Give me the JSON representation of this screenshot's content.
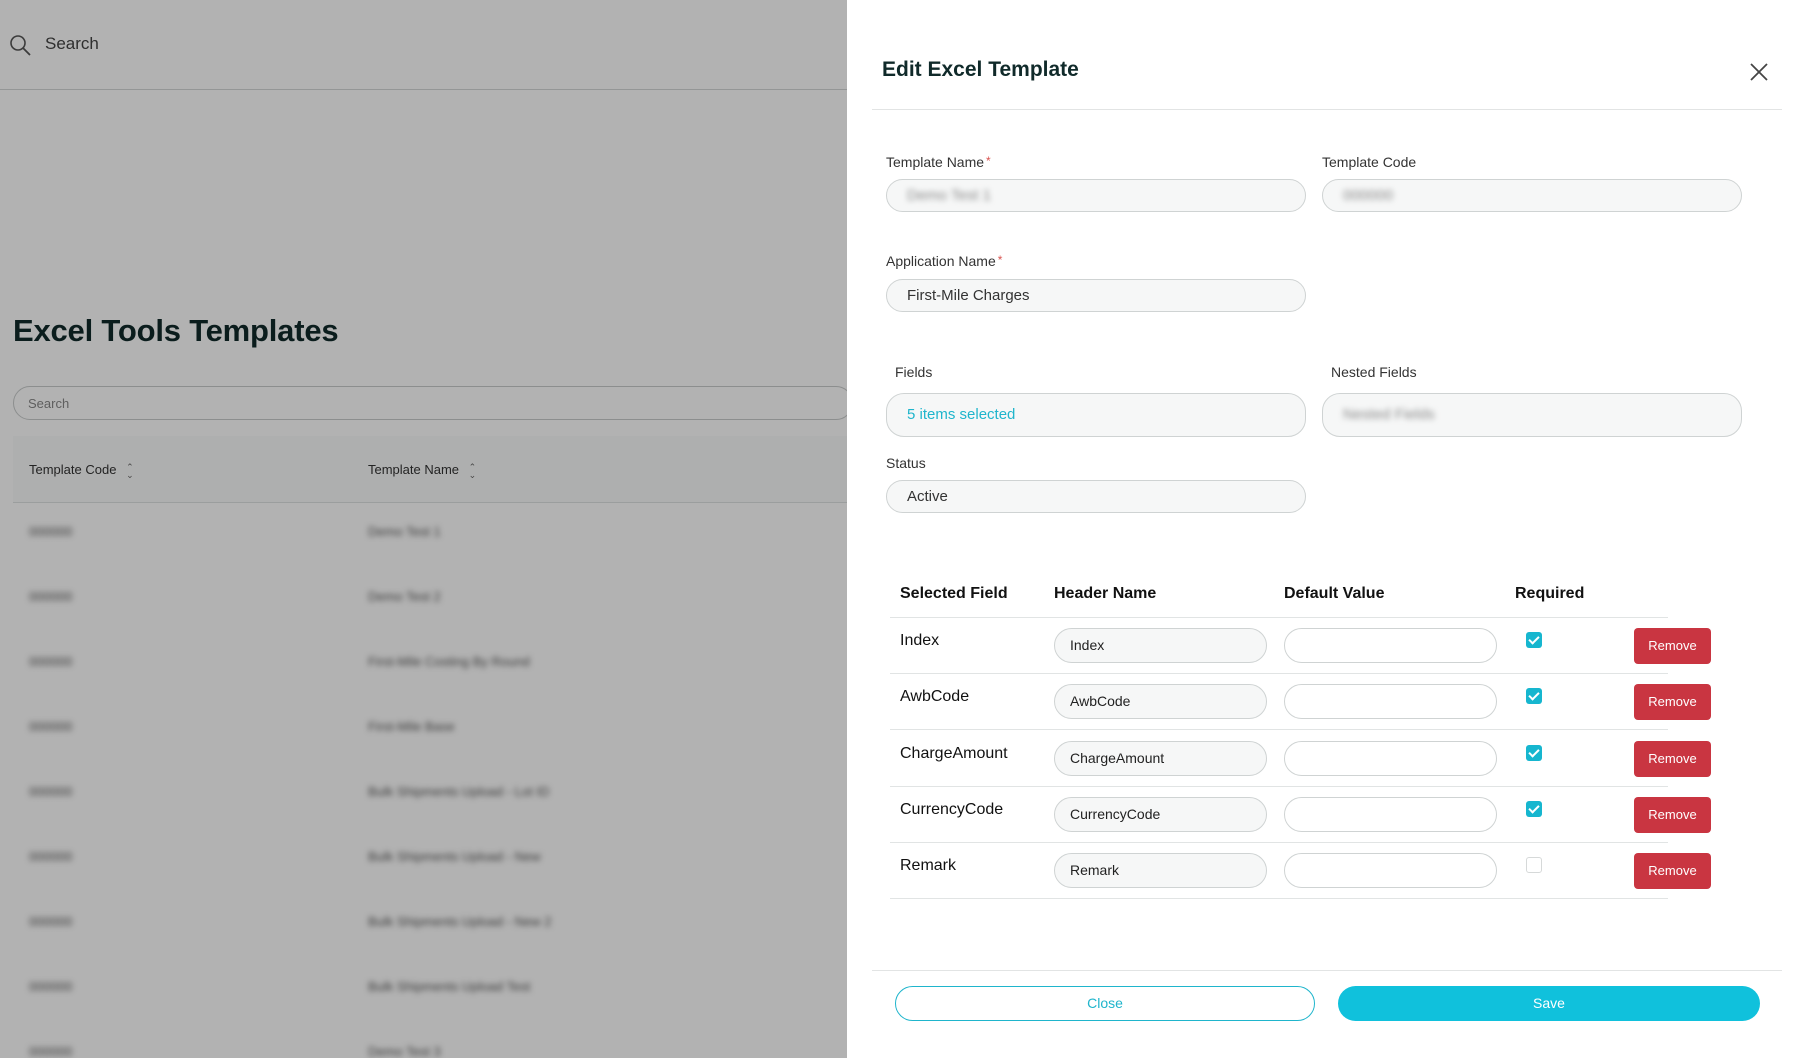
{
  "background": {
    "search_placeholder": "Search",
    "page_title": "Excel Tools Templates",
    "list_search_placeholder": "Search",
    "columns": [
      "Template Code",
      "Template Name"
    ],
    "rows": [
      {
        "code": "000000",
        "name": "Demo Test 1"
      },
      {
        "code": "000000",
        "name": "Demo Test 2"
      },
      {
        "code": "000000",
        "name": "First-Mile Costing By Round"
      },
      {
        "code": "000000",
        "name": "First-Mile Base"
      },
      {
        "code": "000000",
        "name": "Bulk Shipments Upload - Lot ID"
      },
      {
        "code": "000000",
        "name": "Bulk Shipments Upload - New"
      },
      {
        "code": "000000",
        "name": "Bulk Shipments Upload - New 2"
      },
      {
        "code": "000000",
        "name": "Bulk Shipments Upload Test"
      },
      {
        "code": "000000",
        "name": "Demo Test 3"
      }
    ]
  },
  "drawer": {
    "title": "Edit Excel Template",
    "labels": {
      "template_name": "Template Name",
      "template_code": "Template Code",
      "application_name": "Application Name",
      "fields": "Fields",
      "nested_fields": "Nested Fields",
      "status": "Status"
    },
    "required_mark": "*",
    "values": {
      "template_name": "Demo Test 1",
      "template_code": "000000",
      "application_name": "First-Mile Charges",
      "fields": "5 items selected",
      "nested_fields": "Nested Fields",
      "status": "Active"
    },
    "table": {
      "headers": [
        "Selected Field",
        "Header Name",
        "Default Value",
        "Required"
      ],
      "remove_label": "Remove",
      "rows": [
        {
          "field": "Index",
          "header": "Index",
          "default": "",
          "required": true
        },
        {
          "field": "AwbCode",
          "header": "AwbCode",
          "default": "",
          "required": true
        },
        {
          "field": "ChargeAmount",
          "header": "ChargeAmount",
          "default": "",
          "required": true
        },
        {
          "field": "CurrencyCode",
          "header": "CurrencyCode",
          "default": "",
          "required": true
        },
        {
          "field": "Remark",
          "header": "Remark",
          "default": "",
          "required": false
        }
      ]
    },
    "footer": {
      "close_label": "Close",
      "save_label": "Save"
    },
    "colors": {
      "accent": "#10c1dc",
      "remove": "#c93541"
    }
  }
}
